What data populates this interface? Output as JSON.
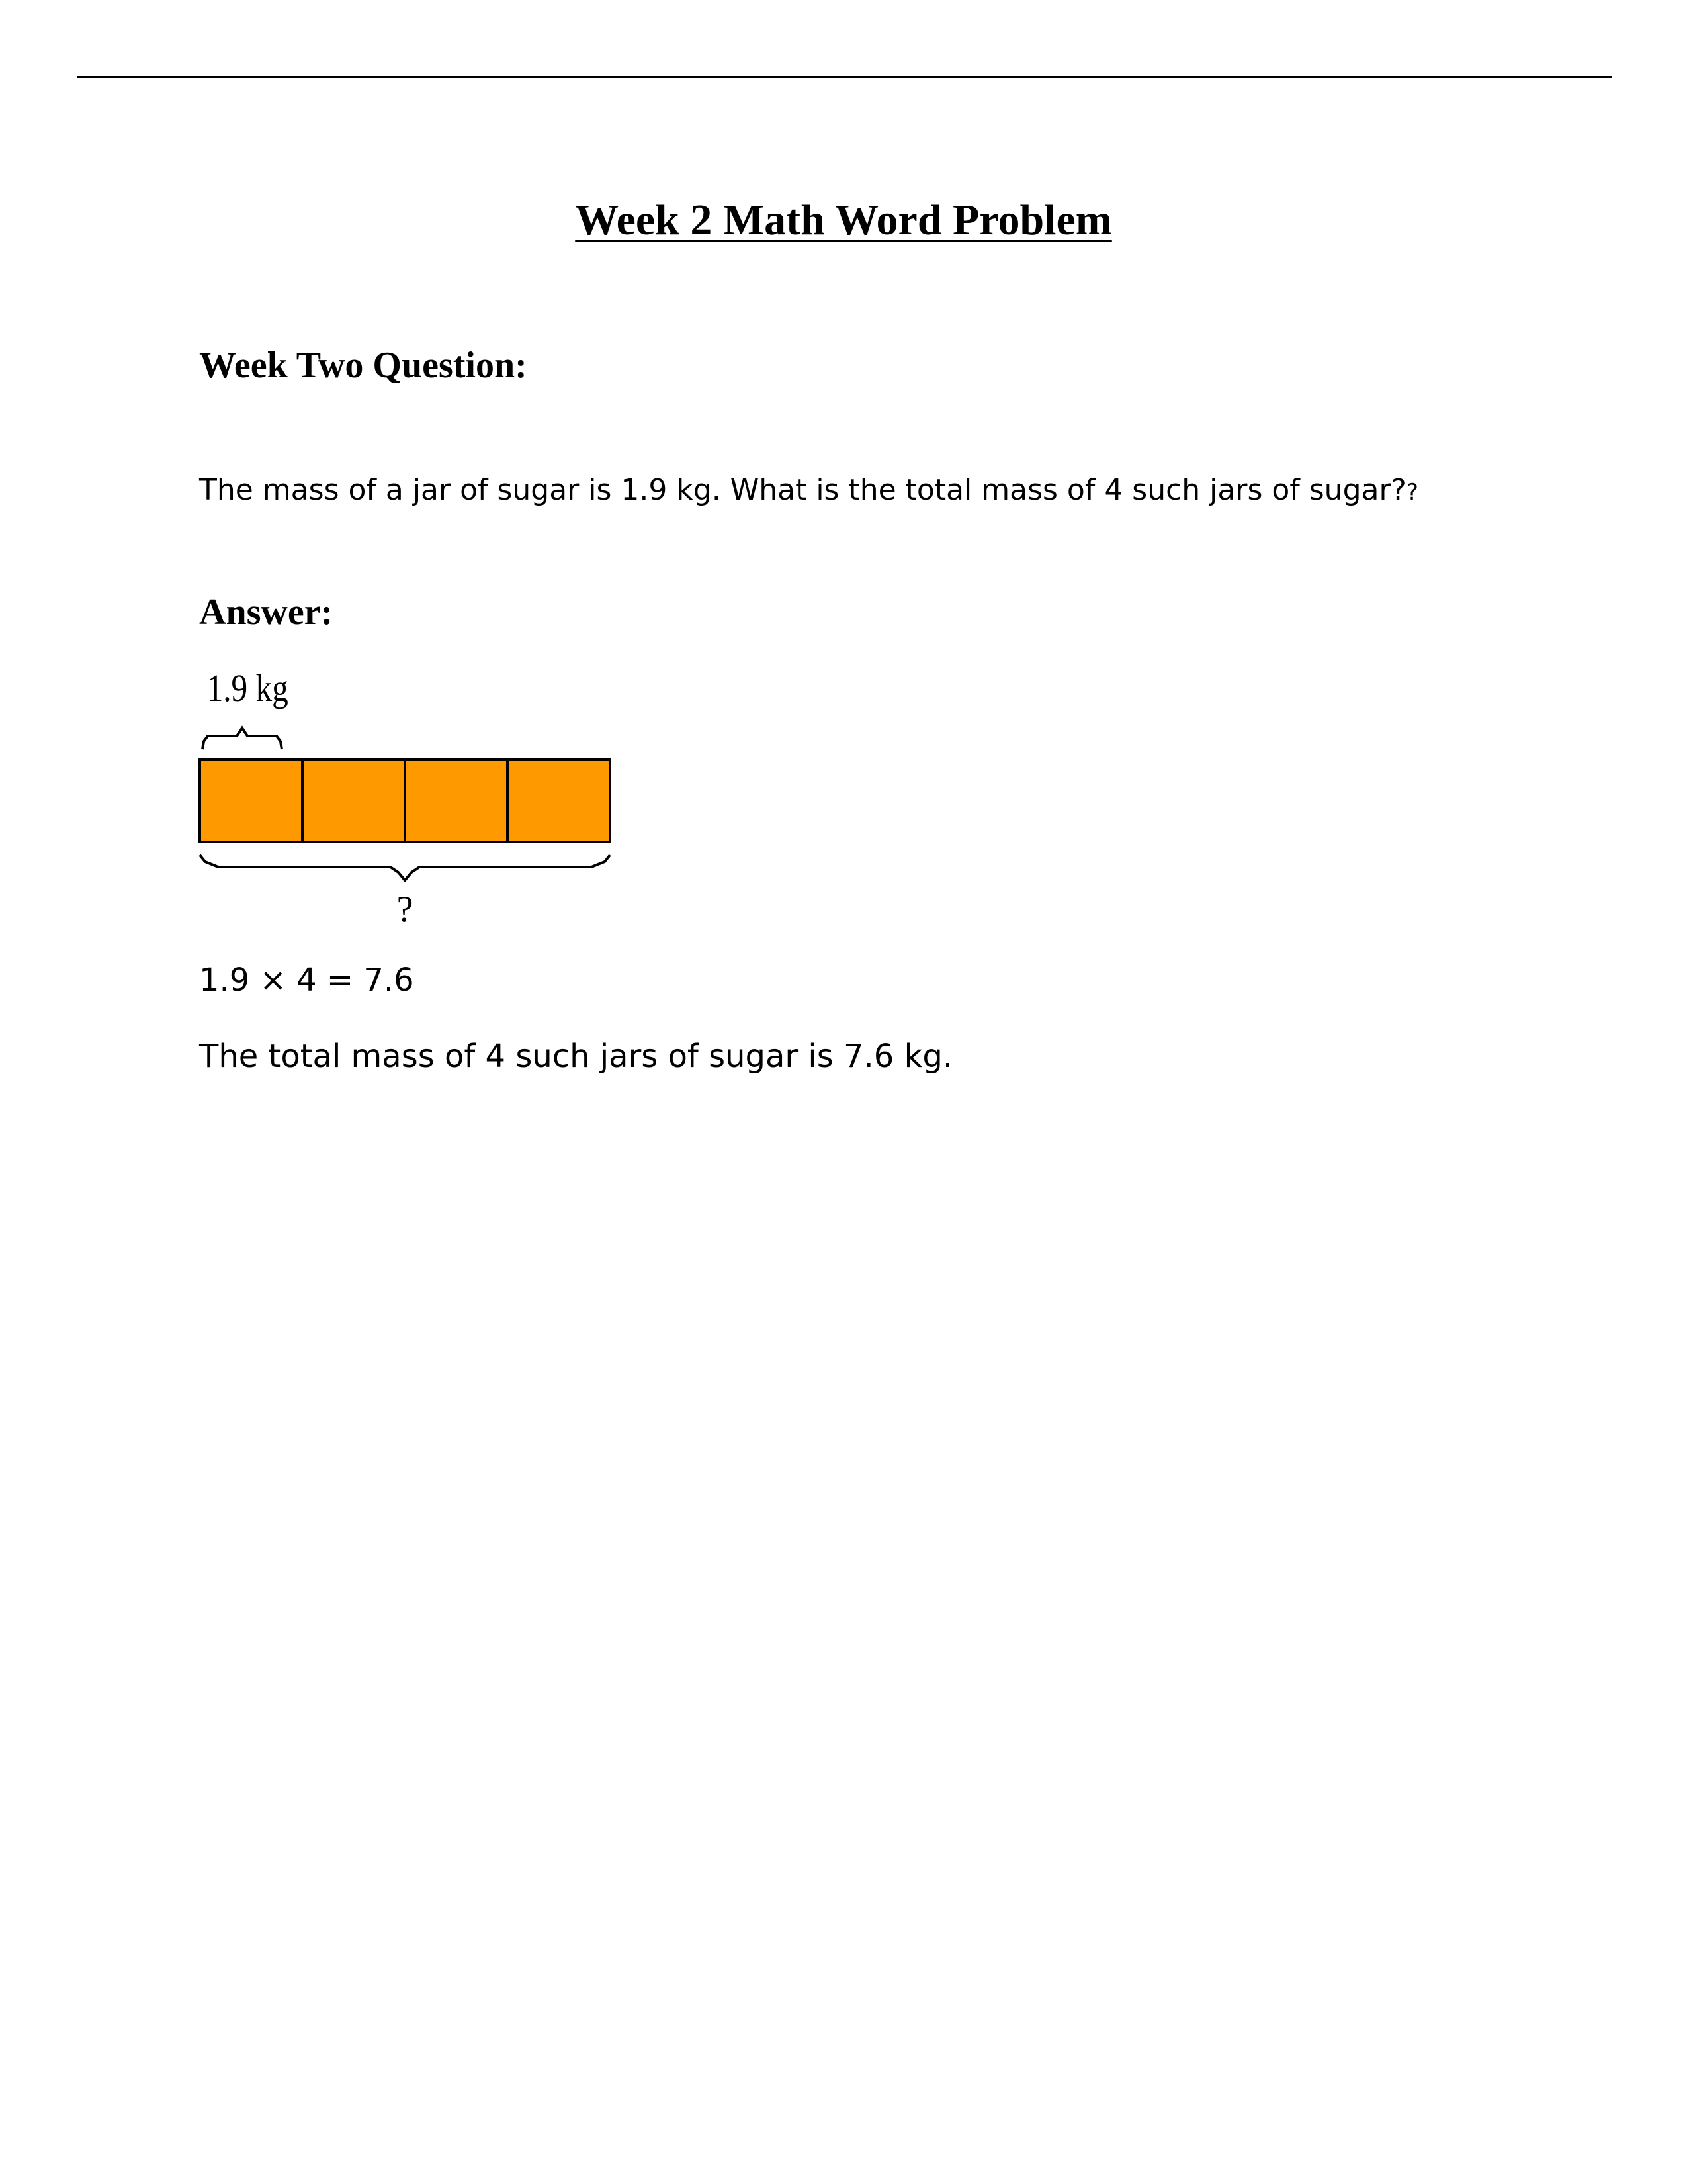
{
  "document": {
    "title": "Week 2 Math Word Problem",
    "question_heading": "Week Two Question:",
    "question_text": "The mass of a jar of sugar is 1.9 kg. What is the total mass of 4 such jars of sugar?",
    "question_trailing_mark": "?",
    "answer_heading": "Answer:",
    "diagram": {
      "type": "bar-model",
      "unit_label": "1.9 kg",
      "total_label": "?",
      "segments": 4,
      "fill_color": "#FF9900",
      "stroke_color": "#000000"
    },
    "equation": "1.9 × 4 = 7.6",
    "conclusion": "The total mass of 4 such jars of sugar is 7.6 kg."
  }
}
